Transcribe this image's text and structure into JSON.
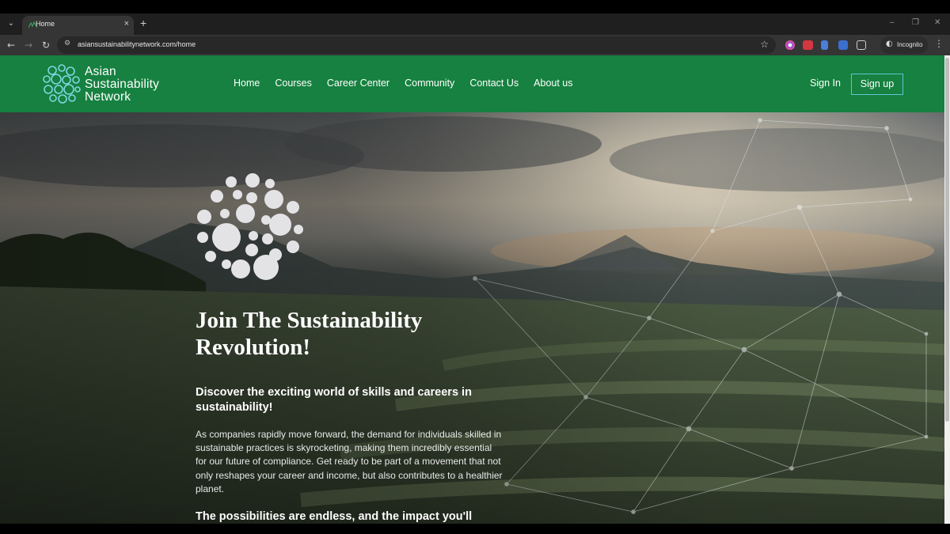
{
  "browser": {
    "tab_title": "Home",
    "tab_close": "×",
    "new_tab": "+",
    "url": "asiansustainabilitynetwork.com/home",
    "incognito_label": "Incognito",
    "window_controls": [
      "–",
      "❐",
      "✕"
    ]
  },
  "site": {
    "logo_lines": [
      "Asian",
      "Sustainability",
      "Network"
    ],
    "brand_color": "#168140",
    "nav": [
      "Home",
      "Courses",
      "Career Center",
      "Community",
      "Contact Us",
      "About us"
    ],
    "sign_in": "Sign In",
    "sign_up": "Sign up"
  },
  "hero": {
    "title": "Join The Sustainability Revolution!",
    "subtitle": "Discover the exciting world of skills and careers in sustainability!",
    "body": "As companies rapidly move forward, the demand for individuals skilled in sustainable practices is skyrocketing, making them incredibly essential for our future of compliance. Get ready to be part of a movement that not only reshapes your career and income, but also contributes to a healthier planet.",
    "more": "The possibilities are endless, and the impact you'll"
  }
}
